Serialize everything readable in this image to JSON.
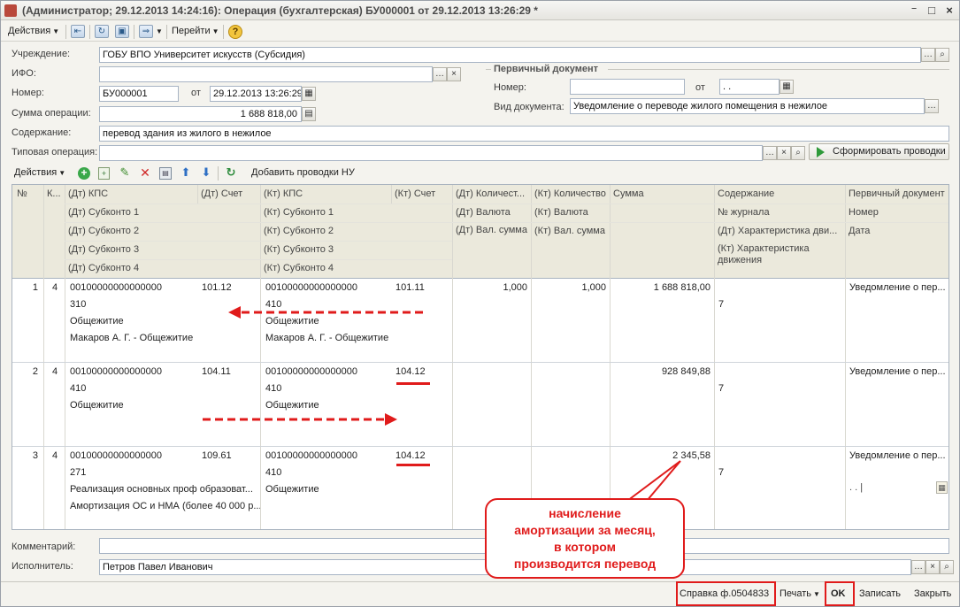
{
  "window": {
    "title": "(Администратор; 29.12.2013 14:24:16): Операция (бухгалтерская) БУ000001 от 29.12.2013 13:26:29 *",
    "controls": [
      "⁻",
      "□",
      "×"
    ]
  },
  "toolbar": {
    "actions": "Действия",
    "goto": "Перейти",
    "help": "?"
  },
  "form": {
    "uchr_label": "Учреждение:",
    "uchr_value": "ГОБУ ВПО Университет искусств (Субсидия)",
    "ifo_label": "ИФО:",
    "ifo_value": "",
    "nomer_label": "Номер:",
    "nomer_value": "БУ000001",
    "ot_label": "от",
    "date_value": "29.12.2013 13:26:29",
    "summa_label": "Сумма операции:",
    "summa_value": "1 688 818,00",
    "soderzh_label": "Содержание:",
    "soderzh_value": "перевод здания из жилого в нежилое",
    "tipovaya_label": "Типовая операция:",
    "tipovaya_value": "",
    "formir_button": "Сформировать проводки"
  },
  "primary_doc": {
    "title": "Первичный документ",
    "nomer_label": "Номер:",
    "nomer_value": "",
    "ot_label": "от",
    "date_value": " .  .",
    "vid_label": "Вид документа:",
    "vid_value": "Уведомление о переводе жилого помещения в нежилое"
  },
  "grid_toolbar": {
    "actions": "Действия",
    "add_nu": "Добавить проводки НУ"
  },
  "grid": {
    "headers": {
      "num": "№",
      "k": "К...",
      "dt_kps": "(Дт) КПС",
      "dt_schet": "(Дт) Счет",
      "kt_kps": "(Кт) КПС",
      "kt_schet": "(Кт) Счет",
      "dt_kol": "(Дт) Количест...",
      "kt_kol": "(Кт) Количество",
      "summa": "Сумма",
      "soderzh": "Содержание",
      "perv_doc": "Первичный документ",
      "dt_sub1": "(Дт) Субконто 1",
      "kt_sub1": "(Кт) Субконто 1",
      "dt_val": "(Дт) Валюта",
      "kt_val": "(Кт) Валюта",
      "zhurnal": "№ журнала",
      "nomer": "Номер",
      "dt_sub2": "(Дт) Субконто 2",
      "kt_sub2": "(Кт) Субконто 2",
      "dt_valsum": "(Дт) Вал. сумма",
      "kt_valsum": "(Кт) Вал. сумма",
      "dt_har": "(Дт) Характеристика дви...",
      "data": "Дата",
      "dt_sub3": "(Дт) Субконто 3",
      "kt_sub3": "(Кт) Субконто 3",
      "kt_har": "(Кт) Характеристика движения",
      "dt_sub4": "(Дт) Субконто 4",
      "kt_sub4": "(Кт) Субконто 4"
    },
    "rows": [
      {
        "num": "1",
        "k": "4",
        "dt_kps": "00100000000000000",
        "dt_schet": "101.12",
        "kt_kps": "00100000000000000",
        "kt_schet": "101.11",
        "dt_kol": "1,000",
        "kt_kol": "1,000",
        "summa": "1 688 818,00",
        "perv_doc": "Уведомление о пер...",
        "dt_sub1": "310",
        "kt_sub1": "410",
        "zhurnal": "7",
        "dt_sub2": "Общежитие",
        "kt_sub2": "Общежитие",
        "dt_sub3": "Макаров А. Г. - Общежитие",
        "kt_sub3": "Макаров А. Г. - Общежитие"
      },
      {
        "num": "2",
        "k": "4",
        "dt_kps": "00100000000000000",
        "dt_schet": "104.11",
        "kt_kps": "00100000000000000",
        "kt_schet": "104.12",
        "summa": "928 849,88",
        "perv_doc": "Уведомление о пер...",
        "dt_sub1": "410",
        "kt_sub1": "410",
        "zhurnal": "7",
        "dt_sub2": "Общежитие",
        "kt_sub2": "Общежитие"
      },
      {
        "num": "3",
        "k": "4",
        "dt_kps": "00100000000000000",
        "dt_schet": "109.61",
        "kt_kps": "00100000000000000",
        "kt_schet": "104.12",
        "summa": "2 345,58",
        "perv_doc": "Уведомление о пер...",
        "dt_sub1": "271",
        "kt_sub1": "410",
        "zhurnal": "7",
        "dt_sub2": "Реализация основных проф образоват...",
        "kt_sub2": "Общежитие",
        "dt_sub3": "Амортизация ОС и НМА (более 40 000 р...",
        "date_edit": " .  .   |"
      }
    ]
  },
  "footer": {
    "comment_label": "Комментарий:",
    "comment_value": "",
    "isp_label": "Исполнитель:",
    "isp_value": "Петров Павел Иванович"
  },
  "bottom_bar": {
    "spravka": "Справка ф.0504833",
    "print": "Печать",
    "ok": "OK",
    "save": "Записать",
    "close": "Закрыть"
  },
  "annotation": {
    "line1": "начисление",
    "line2": "амортизации за месяц,",
    "line3": "в котором",
    "line4": "производится перевод"
  },
  "colors": {
    "accent_red": "#e01b1b",
    "header_band": "#ebe9dc"
  }
}
